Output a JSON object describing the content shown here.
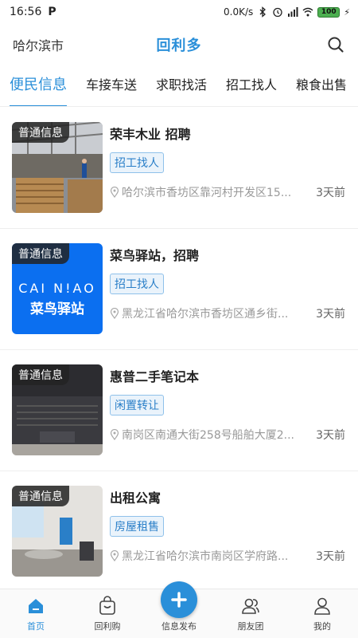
{
  "status_bar": {
    "time": "16:56",
    "app_letter": "P",
    "network_speed": "0.0K/s",
    "battery": "100"
  },
  "header": {
    "city": "哈尔滨市",
    "brand": "回利多",
    "search_icon": "search-icon"
  },
  "tabs": [
    {
      "label": "便民信息",
      "active": true
    },
    {
      "label": "车接车送",
      "active": false
    },
    {
      "label": "求职找活",
      "active": false
    },
    {
      "label": "招工找人",
      "active": false
    },
    {
      "label": "粮食出售",
      "active": false
    }
  ],
  "listings": [
    {
      "badge": "普通信息",
      "title": "荣丰木业 招聘",
      "tag": "招工找人",
      "location": "哈尔滨市香坊区靠河村开发区15...",
      "time": "3天前",
      "image_icon": "factory-photo"
    },
    {
      "badge": "普通信息",
      "title": "菜鸟驿站，招聘",
      "tag": "招工找人",
      "location": "黑龙江省哈尔滨市香坊区通乡街...",
      "time": "3天前",
      "image_icon": "cainiao-logo"
    },
    {
      "badge": "普通信息",
      "title": "惠普二手笔记本",
      "tag": "闲置转让",
      "location": "南岗区南通大街258号船舶大厦2...",
      "time": "3天前",
      "image_icon": "laptop-photo"
    },
    {
      "badge": "普通信息",
      "title": "出租公寓",
      "tag": "房屋租售",
      "location": "黑龙江省哈尔滨市南岗区学府路...",
      "time": "3天前",
      "image_icon": "apartment-photo"
    }
  ],
  "logo_text": {
    "latin": "CAI N!AO",
    "chinese": "菜鸟驿站"
  },
  "bottom_nav": [
    {
      "label": "首页",
      "icon": "home-icon",
      "active": true
    },
    {
      "label": "回利购",
      "icon": "shopping-bag-icon",
      "active": false
    },
    {
      "label": "信息发布",
      "icon": "plus-icon",
      "active": false
    },
    {
      "label": "朋友团",
      "icon": "group-icon",
      "active": false
    },
    {
      "label": "我的",
      "icon": "user-icon",
      "active": false
    }
  ],
  "colors": {
    "accent": "#2a8fd9",
    "tag_bg": "#eaf3fb",
    "tag_border": "#8fc1ea",
    "battery": "#4caf50",
    "cainiao_blue": "#0b6ff0"
  }
}
